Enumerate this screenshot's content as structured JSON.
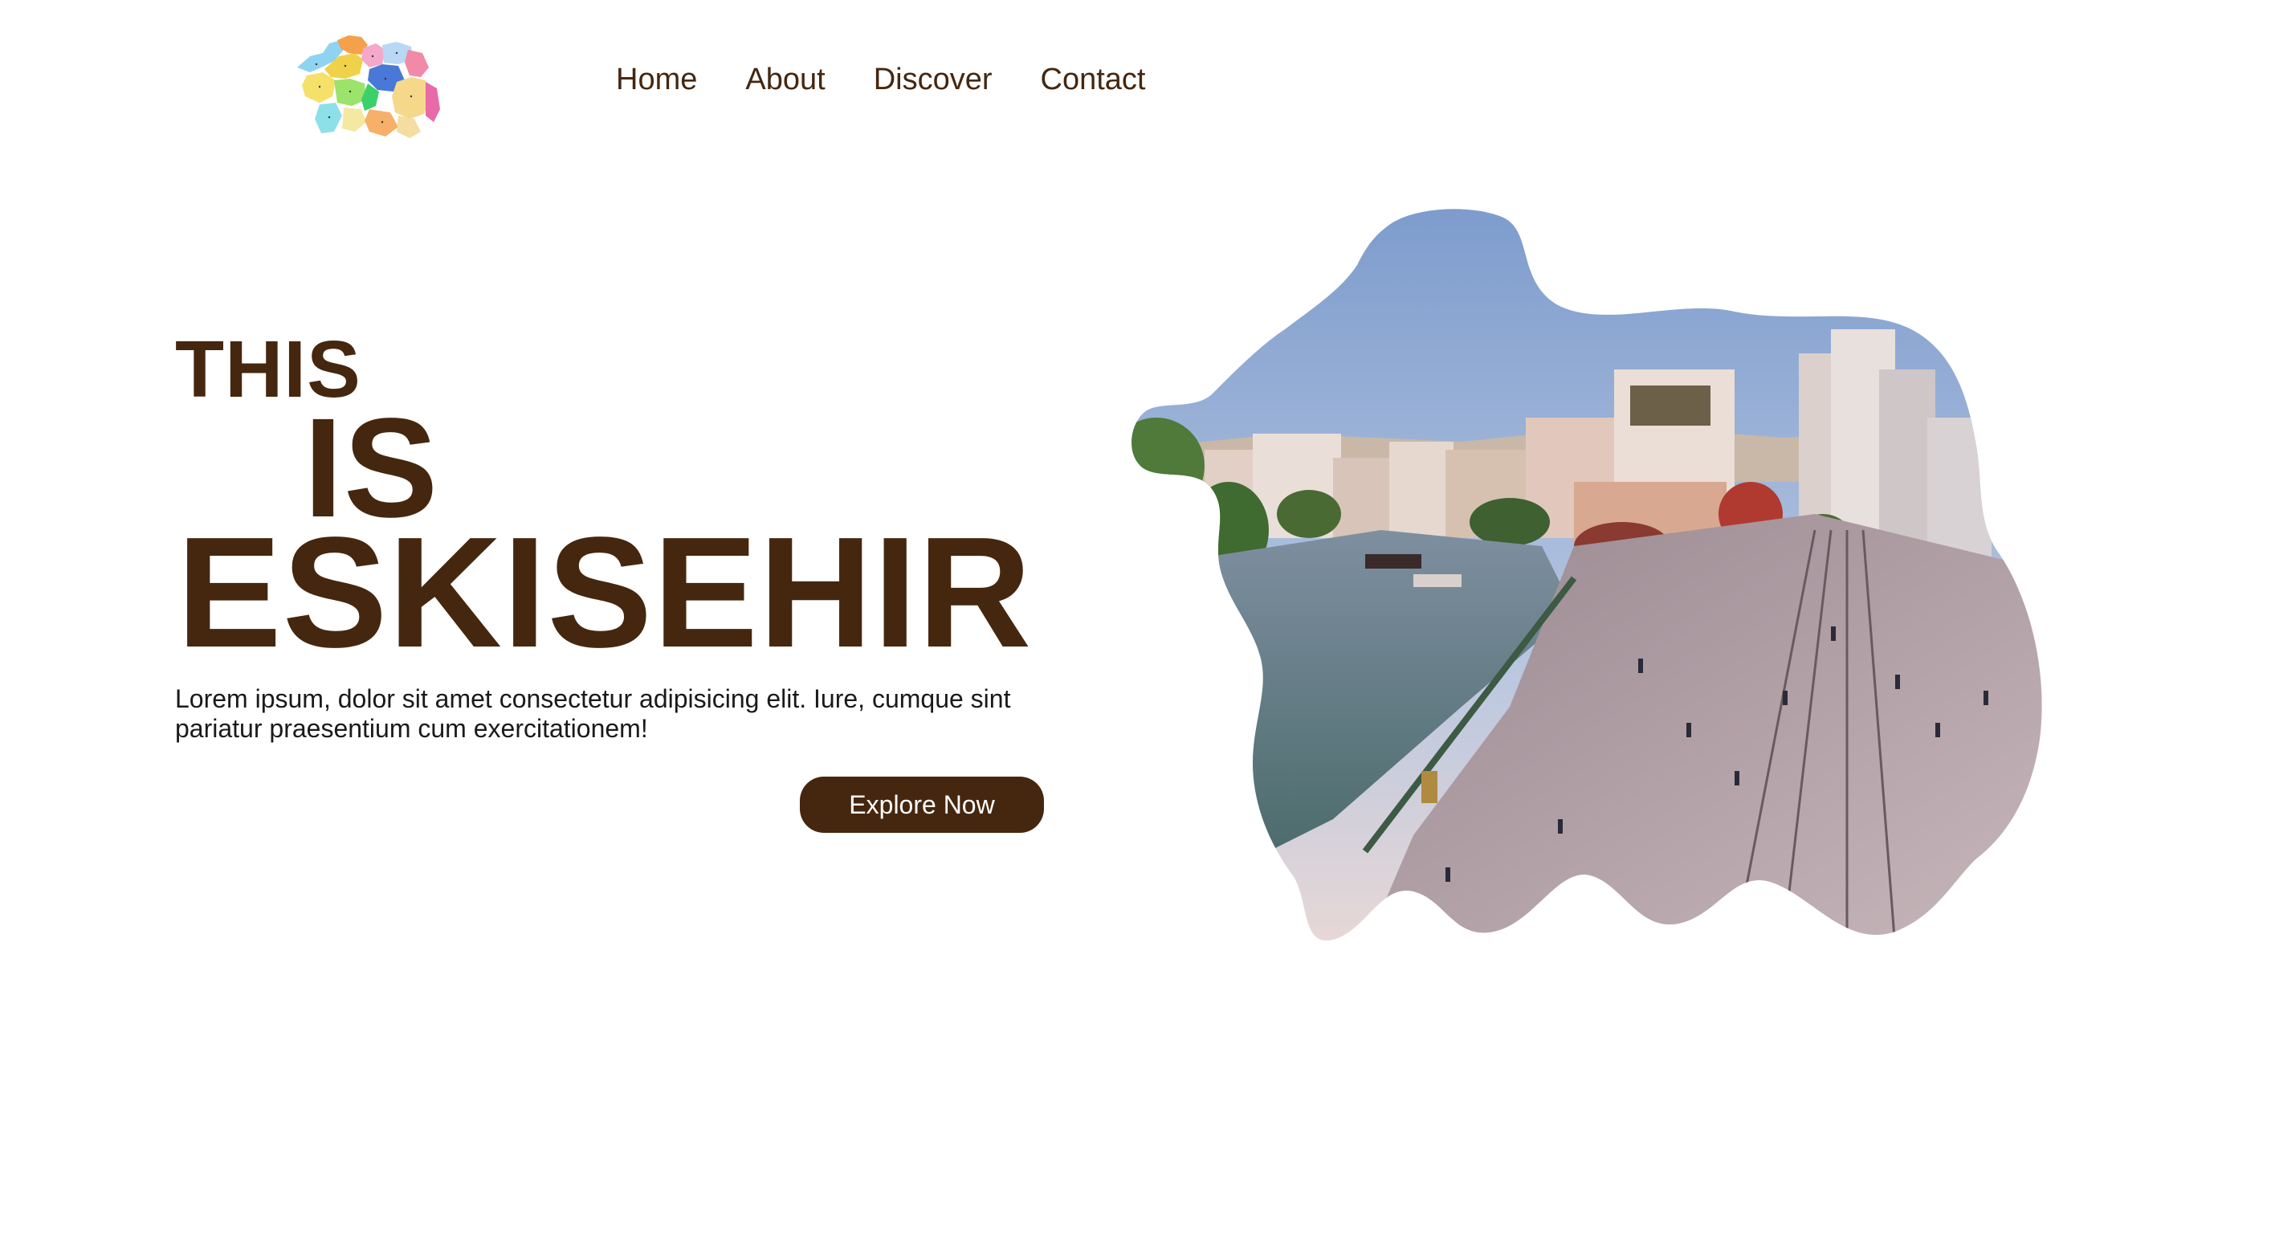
{
  "nav": {
    "items": [
      {
        "label": "Home"
      },
      {
        "label": "About"
      },
      {
        "label": "Discover"
      },
      {
        "label": "Contact"
      }
    ]
  },
  "hero": {
    "title_line1": "THIS",
    "title_line2": "IS",
    "title_line3": "ESKISEHIR",
    "description": "Lorem ipsum, dolor sit amet consectetur adipisicing elit. Iure, cumque sint pariatur praesentium cum exercitationem!",
    "cta_label": "Explore Now"
  },
  "colors": {
    "brand": "#45270f",
    "background": "#ffffff",
    "body_text": "#1a1a1a"
  },
  "icons": {
    "logo": "province-map-logo-icon"
  }
}
